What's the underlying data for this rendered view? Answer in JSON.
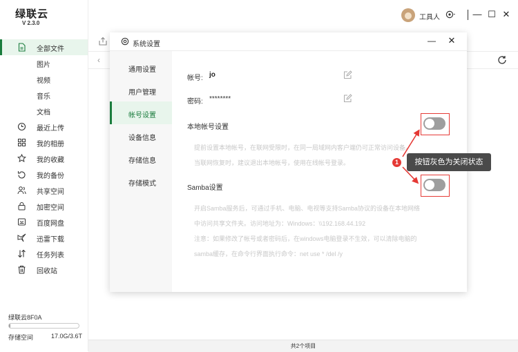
{
  "app": {
    "brand": "绿联云",
    "version": "V 2.3.0"
  },
  "sidebar": {
    "items": [
      {
        "label": "全部文件",
        "icon": "file-icon",
        "active": true
      },
      {
        "label": "图片",
        "icon": "",
        "sub": true
      },
      {
        "label": "视频",
        "icon": "",
        "sub": true
      },
      {
        "label": "音乐",
        "icon": "",
        "sub": true
      },
      {
        "label": "文档",
        "icon": "",
        "sub": true
      },
      {
        "label": "最近上传",
        "icon": "clock-icon"
      },
      {
        "label": "我的相册",
        "icon": "album-icon"
      },
      {
        "label": "我的收藏",
        "icon": "star-icon"
      },
      {
        "label": "我的备份",
        "icon": "backup-icon"
      },
      {
        "label": "共享空间",
        "icon": "share-icon"
      },
      {
        "label": "加密空间",
        "icon": "lock-icon"
      },
      {
        "label": "百度网盘",
        "icon": "cloud-drive-icon"
      },
      {
        "label": "迅雷下载",
        "icon": "thunder-icon"
      },
      {
        "label": "任务列表",
        "icon": "task-list-icon"
      },
      {
        "label": "回收站",
        "icon": "trash-icon"
      }
    ],
    "storage": {
      "device_name": "绿联云8F0A",
      "label": "存储空间",
      "usage": "17.0G/3.6T",
      "used_fraction": 0.005
    }
  },
  "topbar": {
    "username": "工具人",
    "minimize": "—",
    "maximize": "☐",
    "close": "✕"
  },
  "statusbar": {
    "text": "共2个项目"
  },
  "dialog": {
    "title": "系统设置",
    "menu": [
      {
        "label": "通用设置"
      },
      {
        "label": "用户管理"
      },
      {
        "label": "帐号设置",
        "active": true
      },
      {
        "label": "设备信息"
      },
      {
        "label": "存储信息"
      },
      {
        "label": "存储模式"
      }
    ],
    "account": {
      "username_label": "帐号:",
      "username_value": "jo",
      "password_label": "密码:",
      "password_value": "********"
    },
    "local_account": {
      "title": "本地帐号设置",
      "desc_line1": "提前设置本地帐号，在联网受限时，在同一局域网内客户端仍可正常访问设备。",
      "desc_line2": "当联网恢复时，建议退出本地帐号，使用在线帐号登录。",
      "enabled": false
    },
    "samba": {
      "title": "Samba设置",
      "desc_line1": "开启Samba服务后，可通过手机、电脑、电视等支持Samba协议的设备在本地网络",
      "desc_line2": "中访问共享文件夹。访问地址为：Windows：\\\\192.168.44.192",
      "desc_line3": "注意：如果修改了帐号或者密码后，在windows电脑登录不生效，可以清除电脑的",
      "desc_line4": "samba缓存，在命令行界面执行命令：net use * /del /y",
      "enabled": false
    }
  },
  "annotation": {
    "badge": "1",
    "text": "按钮灰色为关闭状态",
    "color": "#e53935"
  },
  "colors": {
    "accent": "#1a7c3d",
    "toggle_off": "#9e9e9e",
    "highlight_box": "#e53935"
  }
}
